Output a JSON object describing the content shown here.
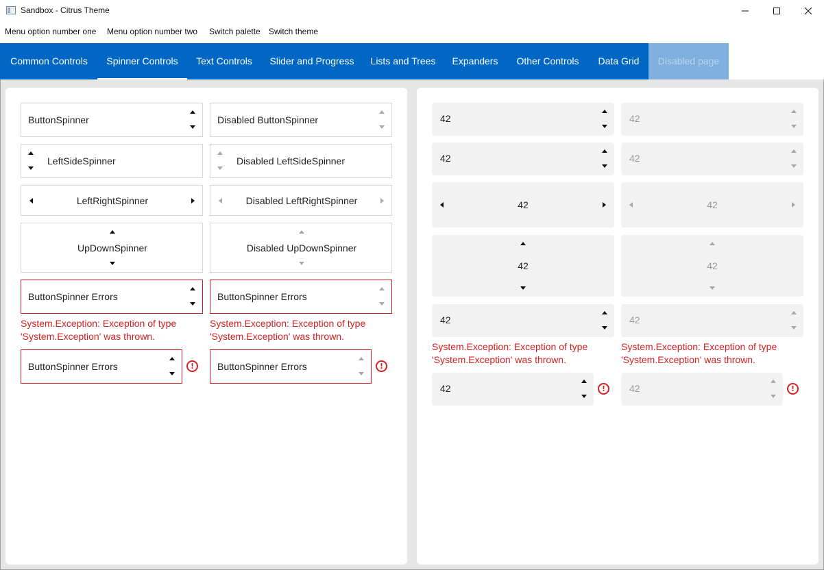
{
  "window": {
    "title": "Sandbox - Citrus Theme"
  },
  "menu": [
    "Menu option number one",
    "Menu option number two",
    "Switch palette",
    "Switch theme"
  ],
  "tabs": [
    {
      "label": "Common Controls"
    },
    {
      "label": "Spinner Controls"
    },
    {
      "label": "Text Controls"
    },
    {
      "label": "Slider and Progress"
    },
    {
      "label": "Lists and Trees"
    },
    {
      "label": "Expanders"
    },
    {
      "label": "Other Controls"
    },
    {
      "label": "Data Grid"
    },
    {
      "label": "Disabled page"
    }
  ],
  "selected_tab": "Spinner Controls",
  "disabled_tab": "Disabled page",
  "left": {
    "button_spinner": "ButtonSpinner",
    "disabled_button_spinner": "Disabled ButtonSpinner",
    "left_side_spinner": "LeftSideSpinner",
    "disabled_left_side_spinner": "Disabled LeftSideSpinner",
    "left_right_spinner": "LeftRightSpinner",
    "disabled_left_right_spinner": "Disabled LeftRightSpinner",
    "up_down_spinner": "UpDownSpinner",
    "disabled_up_down_spinner": "Disabled UpDownSpinner",
    "errors_label": "ButtonSpinner Errors",
    "error_line1": "System.Exception: Exception of type",
    "error_line2": "'System.Exception' was thrown."
  },
  "right": {
    "value": "42",
    "error_line1": "System.Exception: Exception of type",
    "error_line2": "'System.Exception' was thrown."
  },
  "icons": {
    "error": "!"
  },
  "colors": {
    "accent": "#0068c4",
    "error": "#d32020",
    "disabled_tab_bg": "#7fb0e0"
  }
}
